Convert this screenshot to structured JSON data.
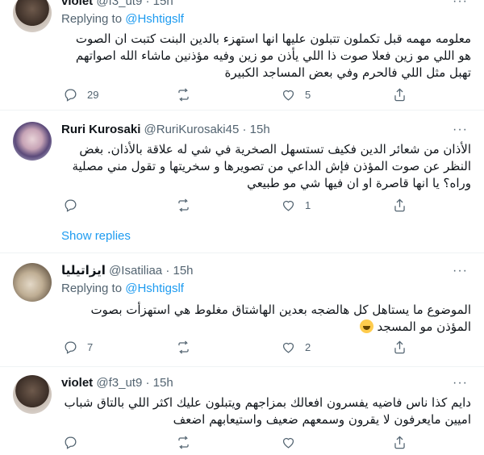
{
  "tweets": [
    {
      "name": "violet",
      "handle": "@f3_ut9",
      "dot": "·",
      "time": "15h",
      "more": "···",
      "replying_prefix": "Replying to ",
      "replying_to": "@Hshtigslf",
      "text": "معلومه مهمه قبل تكملون تتبلون عليها انها استهزء بالدين البنت كتبت ان الصوت هو اللي مو زين فعلا صوت ذا اللي يأذن مو زين وفيه مؤذنين ماشاء الله اصواتهم تهبل مثل اللي فالحرم وفي بعض المساجد الكبيرة",
      "replies": "29",
      "retweets": "",
      "likes": "5"
    },
    {
      "name": "Ruri Kurosaki",
      "handle": "@RuriKurosaki45",
      "dot": "·",
      "time": "15h",
      "more": "···",
      "text": "الأذان من شعائر الدين فكيف تستسهل الصخرية في شي له علاقة بالأذان. بغض النظر عن صوت المؤذن فإش الداعي من تصويرها و سخريتها و تقول مني مصلية وراه؟ يا انها قاصرة او ان فيها شي مو طبيعي",
      "replies": "",
      "retweets": "",
      "likes": "1"
    },
    {
      "name": "ايزاتيليا",
      "handle": "@Isatiliaa",
      "dot": "·",
      "time": "15h",
      "more": "···",
      "replying_prefix": "Replying to ",
      "replying_to": "@Hshtigslf",
      "text": "الموضوع ما يستاهل كل هالضجه بعدين الهاشتاق مغلوط هي استهزأت بصوت المؤذن مو المسجد",
      "replies": "7",
      "retweets": "",
      "likes": "2"
    },
    {
      "name": "violet",
      "handle": "@f3_ut9",
      "dot": "·",
      "time": "15h",
      "more": "···",
      "text": "دايم كذا ناس فاضيه يفسرون افعالك بمزاجهم ويتبلون عليك اكثر اللي بالتاق شباب اميين مايعرفون لا يقرون وسمعهم ضعيف واستيعابهم اضعف",
      "replies": "",
      "retweets": "",
      "likes": ""
    }
  ],
  "show_replies": "Show replies",
  "icons": {
    "reply": "reply-icon",
    "retweet": "retweet-icon",
    "like": "heart-icon",
    "share": "share-icon",
    "emoji": "grinning-sweat-emoji"
  },
  "colors": {
    "link": "#1d9bf0",
    "secondary_text": "#536471",
    "primary_text": "#0f1419",
    "divider": "#eff3f4"
  }
}
